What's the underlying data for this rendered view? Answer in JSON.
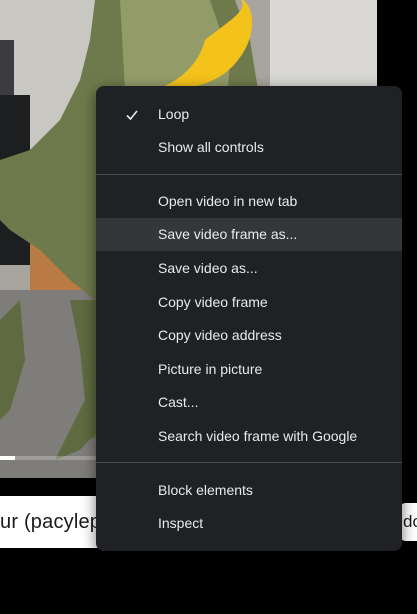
{
  "video": {
    "progress": 0.04
  },
  "menu": {
    "items": [
      {
        "label": "Loop",
        "checked": true
      },
      {
        "label": "Show all controls"
      },
      {
        "label": "Open video in new tab"
      },
      {
        "label": "Save video frame as...",
        "highlighted": true
      },
      {
        "label": "Save video as..."
      },
      {
        "label": "Copy video frame"
      },
      {
        "label": "Copy video address"
      },
      {
        "label": "Picture in picture"
      },
      {
        "label": "Cast..."
      },
      {
        "label": "Search video frame with Google"
      },
      {
        "label": "Block elements"
      },
      {
        "label": "Inspect"
      }
    ],
    "colors": {
      "background": "#202124",
      "text": "#e8eaed",
      "highlight": "#35363a",
      "separator": "#4a4c50"
    }
  },
  "page": {
    "title_fragment": "ur (pacylep",
    "side_button_fragment": "do"
  }
}
